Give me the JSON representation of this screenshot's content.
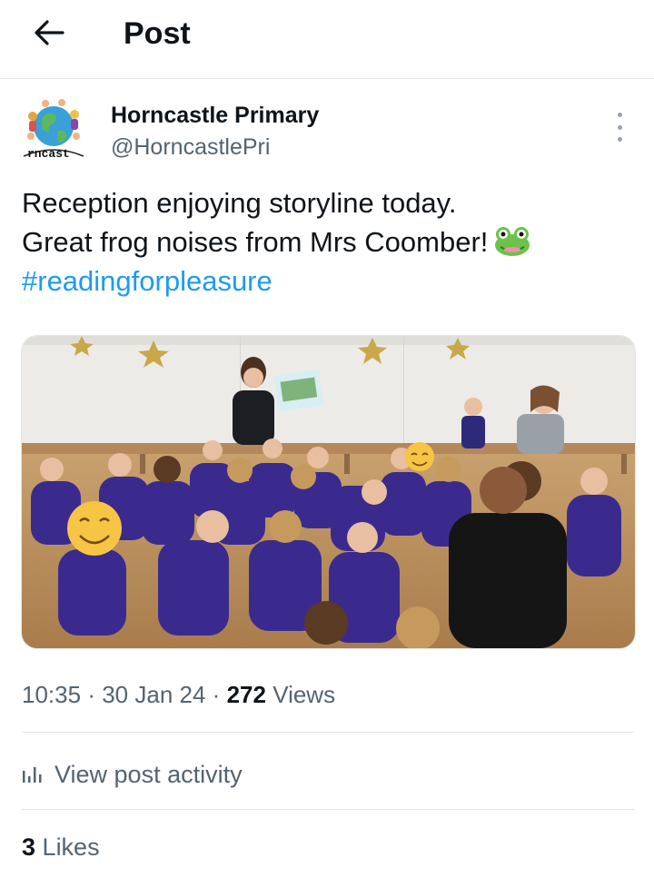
{
  "header": {
    "title": "Post"
  },
  "post": {
    "author_name": "Horncastle Primary",
    "author_handle": "@HorncastlePri",
    "avatar_text": "rncast",
    "text_line1": "Reception enjoying storyline today.",
    "text_line2": "Great frog noises from Mrs Coomber!",
    "hashtag": "#readingforpleasure",
    "emoji": "frog-emoji"
  },
  "meta": {
    "time": "10:35",
    "sep1": "·",
    "date": "30 Jan 24",
    "sep2": "·",
    "views_count": "272",
    "views_label": "Views"
  },
  "activity": {
    "label": "View post activity"
  },
  "likes": {
    "count": "3",
    "label": "Likes"
  },
  "colors": {
    "accent": "#1d9bf0",
    "text": "#0f1419",
    "muted": "#536471",
    "uniform": "#3b2a8e"
  }
}
